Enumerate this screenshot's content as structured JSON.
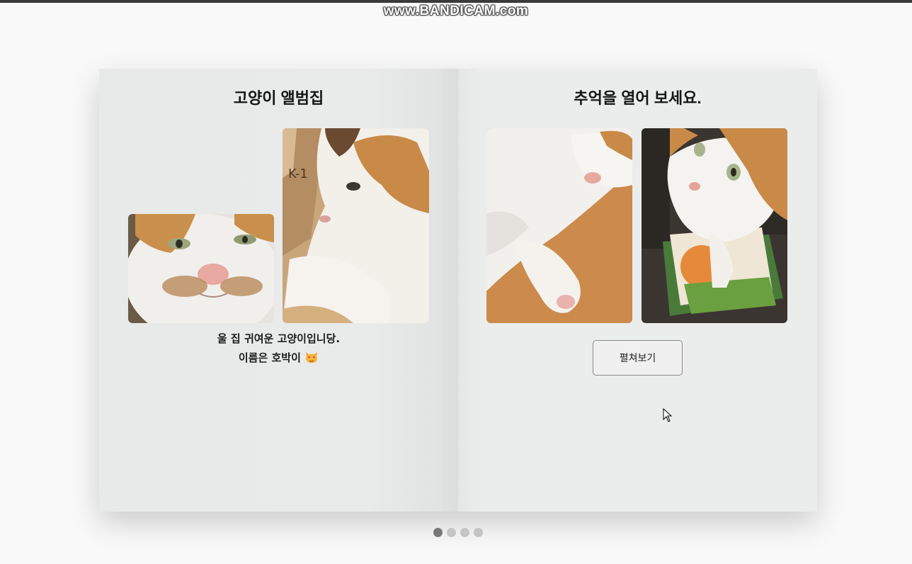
{
  "recording_watermark": "www.BANDICAM.com",
  "album": {
    "left_page": {
      "title": "고양이 앨범집",
      "photos": [
        "cat-closeup-photo",
        "cat-in-box-photo"
      ],
      "caption_line1": "울 집 귀여운 고양이입니당.",
      "caption_line2": "이름은 호박이"
    },
    "right_page": {
      "title": "추억을 열어 보세요.",
      "photos": [
        "cat-lying-photo",
        "cat-standing-photo"
      ],
      "open_button_label": "펼쳐보기"
    },
    "pagination": {
      "total_pages": 4,
      "current_page": 1
    }
  },
  "icons": {
    "caption_emoji": "heart-eyes-cat-emoji",
    "cursor": "mouse-pointer-icon"
  },
  "colors": {
    "page_background": "#e9eaea",
    "body_background": "#f9f9f9",
    "dot_active": "#777777",
    "dot_inactive": "#c4c4c4"
  }
}
